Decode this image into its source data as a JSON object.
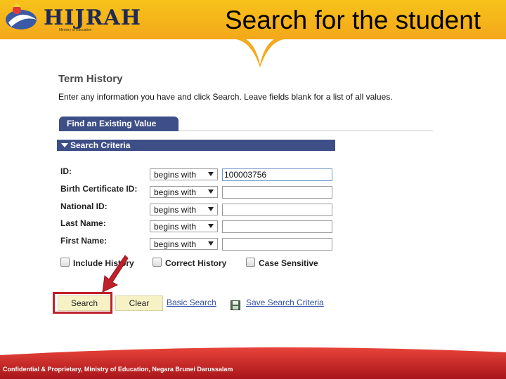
{
  "header": {
    "logo_text": "HIJRAH",
    "logo_sub": "Ministry of Education",
    "slide_title": "Search for the student"
  },
  "page": {
    "title": "Term History",
    "instructions": "Enter any information you have and click Search. Leave fields blank for a list of all values."
  },
  "tab": {
    "label": "Find an Existing Value"
  },
  "section": {
    "label": "Search Criteria"
  },
  "fields": [
    {
      "label": "ID:",
      "operator": "begins with",
      "value": "100003756"
    },
    {
      "label": "Birth Certificate ID:",
      "operator": "begins with",
      "value": ""
    },
    {
      "label": "National ID:",
      "operator": "begins with",
      "value": ""
    },
    {
      "label": "Last Name:",
      "operator": "begins with",
      "value": ""
    },
    {
      "label": "First Name:",
      "operator": "begins with",
      "value": ""
    }
  ],
  "checkboxes": [
    {
      "label": "Include History",
      "checked": false
    },
    {
      "label": "Correct History",
      "checked": false
    },
    {
      "label": "Case Sensitive",
      "checked": false
    }
  ],
  "buttons": {
    "search": "Search",
    "clear": "Clear"
  },
  "links": {
    "basic_search": "Basic Search",
    "save_search": "Save Search Criteria"
  },
  "footer": {
    "text": "Confidential & Proprietary, Ministry of Education, Negara Brunei Darussalam"
  },
  "colors": {
    "header": "#f4b21a",
    "panel_bar": "#3e4f87",
    "footer": "#c41f1f",
    "highlight": "#c0202a"
  }
}
